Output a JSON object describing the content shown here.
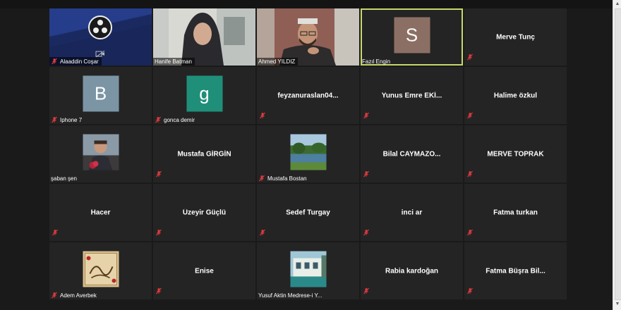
{
  "participants": [
    {
      "name": "Alaaddin Coşar",
      "kind": "screen",
      "muted": true
    },
    {
      "name": "Hanife Batman",
      "kind": "video-woman",
      "muted": false
    },
    {
      "name": "Ahmed YILDIZ",
      "kind": "video-man",
      "muted": false
    },
    {
      "name": "Fazıl Engin",
      "kind": "letter",
      "letter": "S",
      "color": "#8c6f64",
      "muted": false,
      "active": true
    },
    {
      "name": "Merve Tunç",
      "kind": "name",
      "muted": true
    },
    {
      "name": "Iphone 7",
      "kind": "letter",
      "letter": "B",
      "color": "#7b95a5",
      "muted": true
    },
    {
      "name": "gonca demir",
      "kind": "letter",
      "letter": "g",
      "color": "#1f8f7a",
      "muted": true
    },
    {
      "name": "feyzanuraslan04...",
      "kind": "name",
      "muted": true
    },
    {
      "name": "Yunus Emre EKİ...",
      "kind": "name",
      "muted": true
    },
    {
      "name": "Halime özkul",
      "kind": "name",
      "muted": true
    },
    {
      "name": "şaban şen",
      "kind": "photo-man",
      "muted": false
    },
    {
      "name": "Mustafa GİRGİN",
      "kind": "name",
      "muted": true
    },
    {
      "name": "Mustafa Bostan",
      "kind": "photo-lake",
      "muted": true
    },
    {
      "name": "Bilal  CAYMAZO...",
      "kind": "name",
      "muted": true
    },
    {
      "name": "MERVE TOPRAK",
      "kind": "name",
      "muted": true
    },
    {
      "name": "Hacer",
      "kind": "name",
      "muted": true
    },
    {
      "name": "Üzeyir Güçlü",
      "kind": "name",
      "muted": true
    },
    {
      "name": "Sedef Turgay",
      "kind": "name",
      "muted": true
    },
    {
      "name": "inci ar",
      "kind": "name",
      "muted": true
    },
    {
      "name": "Fatma turkan",
      "kind": "name",
      "muted": true
    },
    {
      "name": "Adem Averbek",
      "kind": "photo-calligraphy",
      "muted": true
    },
    {
      "name": "Enise",
      "kind": "name",
      "muted": true
    },
    {
      "name": "Yusuf Aktin Medrese-i Y...",
      "kind": "photo-building",
      "muted": false
    },
    {
      "name": "Rabia kardoğan",
      "kind": "name",
      "muted": true
    },
    {
      "name": "Fatma Büşra Bil...",
      "kind": "name",
      "muted": true
    }
  ],
  "colors": {
    "active_border": "#c6d86a",
    "tile_bg": "#242424",
    "muted_icon": "#e0393e"
  }
}
